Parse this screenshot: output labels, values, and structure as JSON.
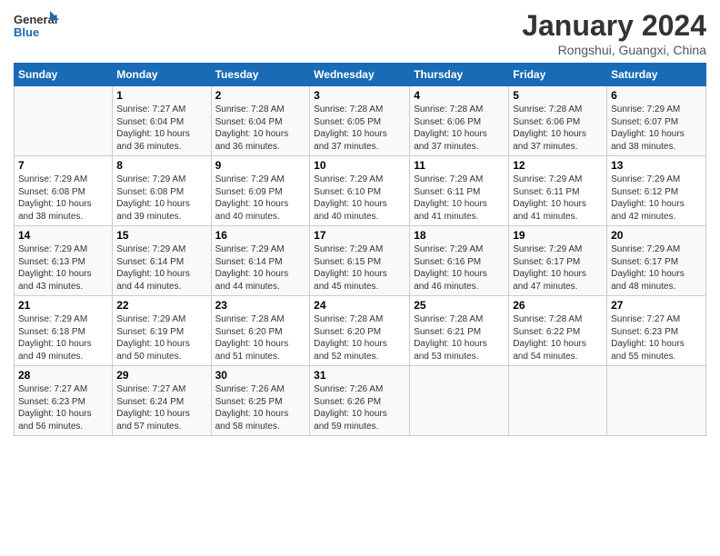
{
  "logo": {
    "line1": "General",
    "line2": "Blue"
  },
  "title": "January 2024",
  "subtitle": "Rongshui, Guangxi, China",
  "columns": [
    "Sunday",
    "Monday",
    "Tuesday",
    "Wednesday",
    "Thursday",
    "Friday",
    "Saturday"
  ],
  "weeks": [
    [
      {
        "num": "",
        "info": ""
      },
      {
        "num": "1",
        "info": "Sunrise: 7:27 AM\nSunset: 6:04 PM\nDaylight: 10 hours\nand 36 minutes."
      },
      {
        "num": "2",
        "info": "Sunrise: 7:28 AM\nSunset: 6:04 PM\nDaylight: 10 hours\nand 36 minutes."
      },
      {
        "num": "3",
        "info": "Sunrise: 7:28 AM\nSunset: 6:05 PM\nDaylight: 10 hours\nand 37 minutes."
      },
      {
        "num": "4",
        "info": "Sunrise: 7:28 AM\nSunset: 6:06 PM\nDaylight: 10 hours\nand 37 minutes."
      },
      {
        "num": "5",
        "info": "Sunrise: 7:28 AM\nSunset: 6:06 PM\nDaylight: 10 hours\nand 37 minutes."
      },
      {
        "num": "6",
        "info": "Sunrise: 7:29 AM\nSunset: 6:07 PM\nDaylight: 10 hours\nand 38 minutes."
      }
    ],
    [
      {
        "num": "7",
        "info": "Sunrise: 7:29 AM\nSunset: 6:08 PM\nDaylight: 10 hours\nand 38 minutes."
      },
      {
        "num": "8",
        "info": "Sunrise: 7:29 AM\nSunset: 6:08 PM\nDaylight: 10 hours\nand 39 minutes."
      },
      {
        "num": "9",
        "info": "Sunrise: 7:29 AM\nSunset: 6:09 PM\nDaylight: 10 hours\nand 40 minutes."
      },
      {
        "num": "10",
        "info": "Sunrise: 7:29 AM\nSunset: 6:10 PM\nDaylight: 10 hours\nand 40 minutes."
      },
      {
        "num": "11",
        "info": "Sunrise: 7:29 AM\nSunset: 6:11 PM\nDaylight: 10 hours\nand 41 minutes."
      },
      {
        "num": "12",
        "info": "Sunrise: 7:29 AM\nSunset: 6:11 PM\nDaylight: 10 hours\nand 41 minutes."
      },
      {
        "num": "13",
        "info": "Sunrise: 7:29 AM\nSunset: 6:12 PM\nDaylight: 10 hours\nand 42 minutes."
      }
    ],
    [
      {
        "num": "14",
        "info": "Sunrise: 7:29 AM\nSunset: 6:13 PM\nDaylight: 10 hours\nand 43 minutes."
      },
      {
        "num": "15",
        "info": "Sunrise: 7:29 AM\nSunset: 6:14 PM\nDaylight: 10 hours\nand 44 minutes."
      },
      {
        "num": "16",
        "info": "Sunrise: 7:29 AM\nSunset: 6:14 PM\nDaylight: 10 hours\nand 44 minutes."
      },
      {
        "num": "17",
        "info": "Sunrise: 7:29 AM\nSunset: 6:15 PM\nDaylight: 10 hours\nand 45 minutes."
      },
      {
        "num": "18",
        "info": "Sunrise: 7:29 AM\nSunset: 6:16 PM\nDaylight: 10 hours\nand 46 minutes."
      },
      {
        "num": "19",
        "info": "Sunrise: 7:29 AM\nSunset: 6:17 PM\nDaylight: 10 hours\nand 47 minutes."
      },
      {
        "num": "20",
        "info": "Sunrise: 7:29 AM\nSunset: 6:17 PM\nDaylight: 10 hours\nand 48 minutes."
      }
    ],
    [
      {
        "num": "21",
        "info": "Sunrise: 7:29 AM\nSunset: 6:18 PM\nDaylight: 10 hours\nand 49 minutes."
      },
      {
        "num": "22",
        "info": "Sunrise: 7:29 AM\nSunset: 6:19 PM\nDaylight: 10 hours\nand 50 minutes."
      },
      {
        "num": "23",
        "info": "Sunrise: 7:28 AM\nSunset: 6:20 PM\nDaylight: 10 hours\nand 51 minutes."
      },
      {
        "num": "24",
        "info": "Sunrise: 7:28 AM\nSunset: 6:20 PM\nDaylight: 10 hours\nand 52 minutes."
      },
      {
        "num": "25",
        "info": "Sunrise: 7:28 AM\nSunset: 6:21 PM\nDaylight: 10 hours\nand 53 minutes."
      },
      {
        "num": "26",
        "info": "Sunrise: 7:28 AM\nSunset: 6:22 PM\nDaylight: 10 hours\nand 54 minutes."
      },
      {
        "num": "27",
        "info": "Sunrise: 7:27 AM\nSunset: 6:23 PM\nDaylight: 10 hours\nand 55 minutes."
      }
    ],
    [
      {
        "num": "28",
        "info": "Sunrise: 7:27 AM\nSunset: 6:23 PM\nDaylight: 10 hours\nand 56 minutes."
      },
      {
        "num": "29",
        "info": "Sunrise: 7:27 AM\nSunset: 6:24 PM\nDaylight: 10 hours\nand 57 minutes."
      },
      {
        "num": "30",
        "info": "Sunrise: 7:26 AM\nSunset: 6:25 PM\nDaylight: 10 hours\nand 58 minutes."
      },
      {
        "num": "31",
        "info": "Sunrise: 7:26 AM\nSunset: 6:26 PM\nDaylight: 10 hours\nand 59 minutes."
      },
      {
        "num": "",
        "info": ""
      },
      {
        "num": "",
        "info": ""
      },
      {
        "num": "",
        "info": ""
      }
    ]
  ]
}
